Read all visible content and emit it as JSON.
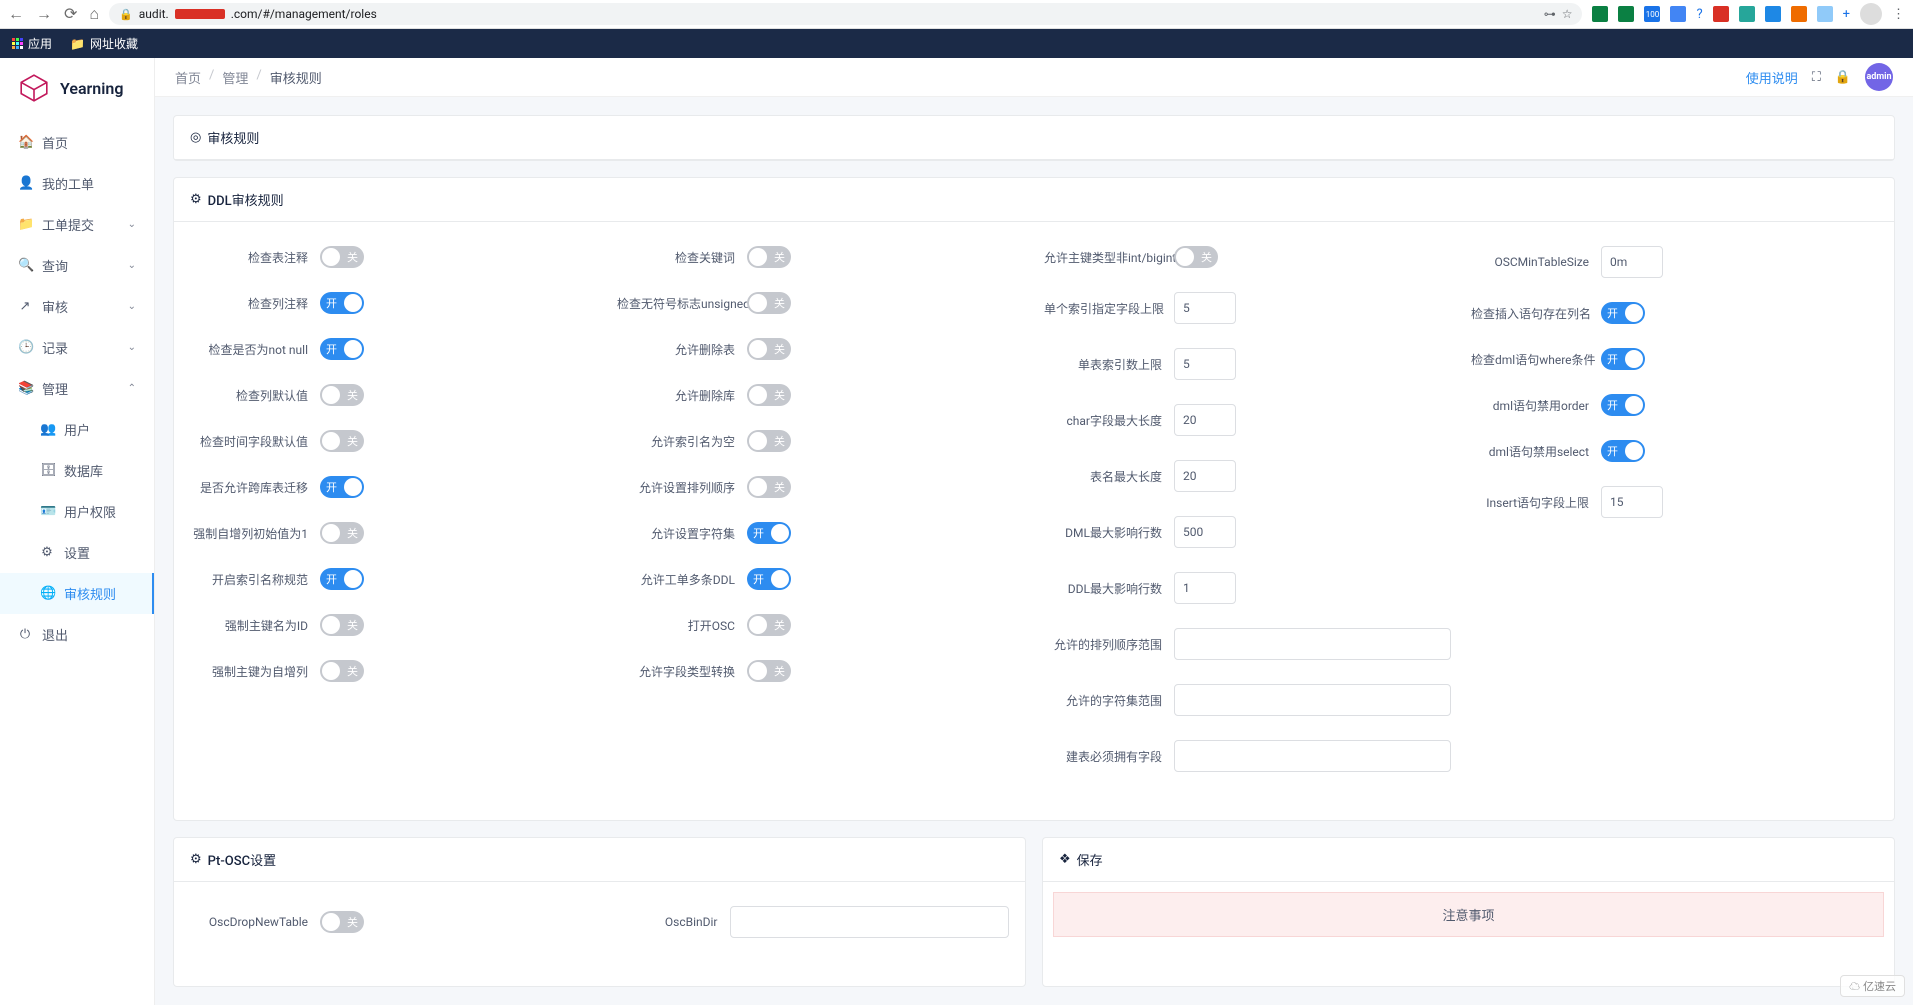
{
  "browser": {
    "url_prefix": "audit.",
    "url_suffix": ".com/#/management/roles",
    "bookmarks": {
      "apps": "应用",
      "favorites": "网址收藏"
    }
  },
  "app": {
    "name": "Yearning",
    "help": "使用说明",
    "admin_badge": "admin"
  },
  "breadcrumb": {
    "home": "首页",
    "manage": "管理",
    "current": "审核规则"
  },
  "sidebar": {
    "home": "首页",
    "mywork": "我的工单",
    "submit": "工单提交",
    "query": "查询",
    "audit": "审核",
    "record": "记录",
    "manage": "管理",
    "users": "用户",
    "database": "数据库",
    "userperm": "用户权限",
    "settings": "设置",
    "rules": "审核规则",
    "logout": "退出"
  },
  "cards": {
    "rules_title": "审核规则",
    "ddl_title": "DDL审核规则",
    "ptosc_title": "Pt-OSC设置",
    "save_title": "保存",
    "attention": "注意事项"
  },
  "switch_label": {
    "on": "开",
    "off": "关"
  },
  "ddl": {
    "col1": [
      {
        "label": "检查表注释",
        "on": false
      },
      {
        "label": "检查列注释",
        "on": true
      },
      {
        "label": "检查是否为not null",
        "on": true
      },
      {
        "label": "检查列默认值",
        "on": false
      },
      {
        "label": "检查时间字段默认值",
        "on": false
      },
      {
        "label": "是否允许跨库表迁移",
        "on": true
      },
      {
        "label": "强制自增列初始值为1",
        "on": false
      },
      {
        "label": "开启索引名称规范",
        "on": true
      },
      {
        "label": "强制主键名为ID",
        "on": false
      },
      {
        "label": "强制主键为自增列",
        "on": false
      }
    ],
    "col2": [
      {
        "label": "检查关键词",
        "on": false
      },
      {
        "label": "检查无符号标志unsigned",
        "on": false
      },
      {
        "label": "允许删除表",
        "on": false
      },
      {
        "label": "允许删除库",
        "on": false
      },
      {
        "label": "允许索引名为空",
        "on": false
      },
      {
        "label": "允许设置排列顺序",
        "on": false
      },
      {
        "label": "允许设置字符集",
        "on": true
      },
      {
        "label": "允许工单多条DDL",
        "on": true
      },
      {
        "label": "打开OSC",
        "on": false
      },
      {
        "label": "允许字段类型转换",
        "on": false
      }
    ],
    "col3": [
      {
        "label": "允许主键类型非int/bigint",
        "type": "switch",
        "on": false
      },
      {
        "label": "单个索引指定字段上限",
        "type": "input",
        "value": "5"
      },
      {
        "label": "单表索引数上限",
        "type": "input",
        "value": "5"
      },
      {
        "label": "char字段最大长度",
        "type": "input",
        "value": "20"
      },
      {
        "label": "表名最大长度",
        "type": "input",
        "value": "20"
      },
      {
        "label": "DML最大影响行数",
        "type": "input",
        "value": "500"
      },
      {
        "label": "DDL最大影响行数",
        "type": "input",
        "value": "1"
      },
      {
        "label": "允许的排列顺序范围",
        "type": "input-wide",
        "value": ""
      },
      {
        "label": "允许的字符集范围",
        "type": "input-wide",
        "value": ""
      },
      {
        "label": "建表必须拥有字段",
        "type": "input-wide",
        "value": ""
      }
    ],
    "col4": [
      {
        "label": "OSCMinTableSize",
        "type": "input",
        "value": "0m"
      },
      {
        "label": "检查插入语句存在列名",
        "type": "switch",
        "on": true
      },
      {
        "label": "检查dml语句where条件",
        "type": "switch",
        "on": true
      },
      {
        "label": "dml语句禁用order",
        "type": "switch",
        "on": true
      },
      {
        "label": "dml语句禁用select",
        "type": "switch",
        "on": true
      },
      {
        "label": "Insert语句字段上限",
        "type": "input",
        "value": "15"
      }
    ]
  },
  "ptosc": {
    "dropnew": "OscDropNewTable",
    "bindir": "OscBinDir"
  },
  "watermark": "亿速云"
}
